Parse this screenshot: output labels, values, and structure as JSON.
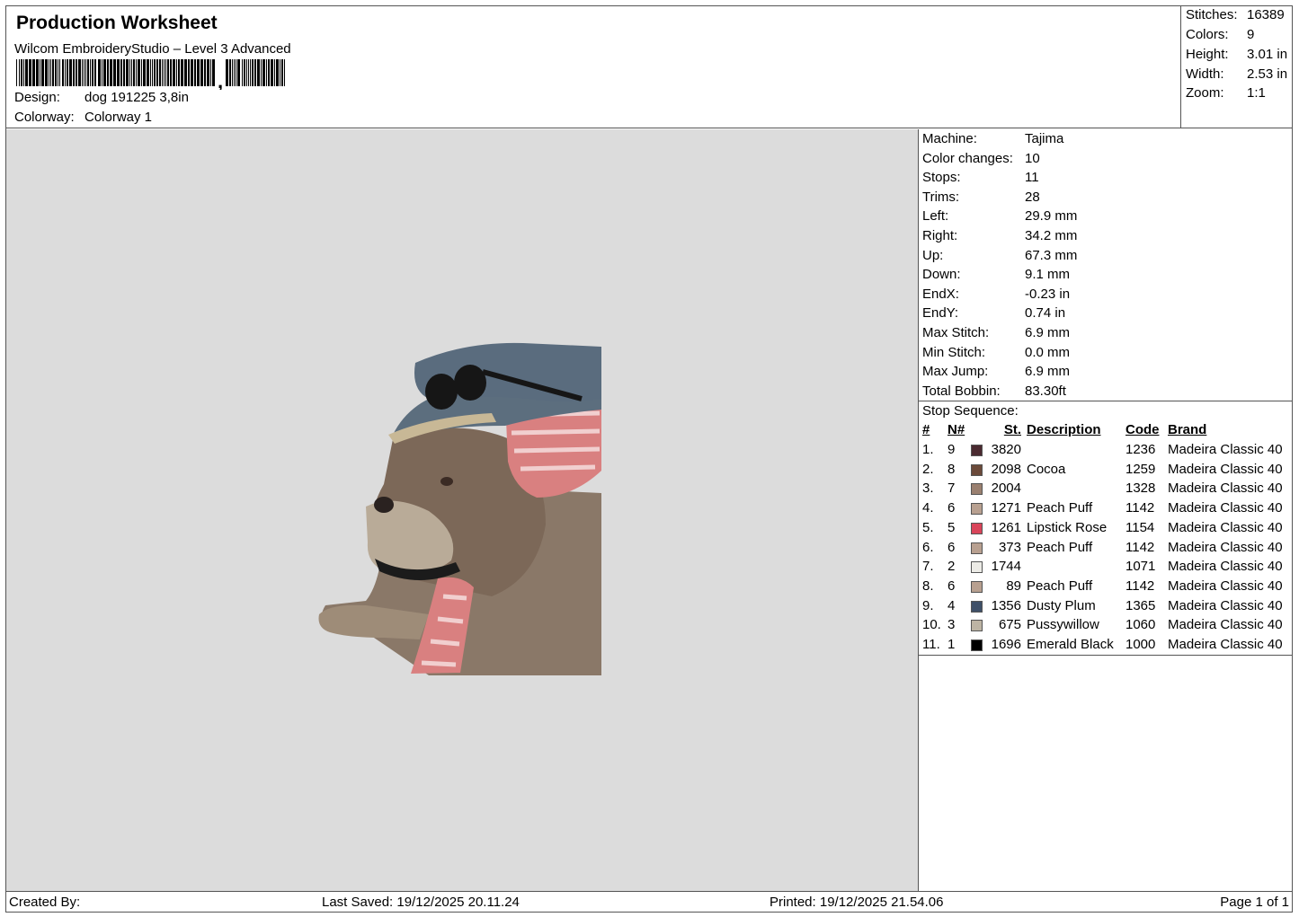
{
  "header": {
    "title": "Production Worksheet",
    "subtitle": "Wilcom EmbroideryStudio – Level 3 Advanced",
    "design_label": "Design:",
    "design_value": "dog 191225 3,8in",
    "colorway_label": "Colorway:",
    "colorway_value": "Colorway 1"
  },
  "summary": {
    "stitches_label": "Stitches:",
    "stitches_value": "16389",
    "colors_label": "Colors:",
    "colors_value": "9",
    "height_label": "Height:",
    "height_value": "3.01 in",
    "width_label": "Width:",
    "width_value": "2.53 in",
    "zoom_label": "Zoom:",
    "zoom_value": "1:1"
  },
  "machine": [
    {
      "label": "Machine:",
      "value": "Tajima"
    },
    {
      "label": "Color changes:",
      "value": "10"
    },
    {
      "label": "Stops:",
      "value": "11"
    },
    {
      "label": "Trims:",
      "value": "28"
    },
    {
      "label": "Left:",
      "value": "29.9 mm"
    },
    {
      "label": "Right:",
      "value": "34.2 mm"
    },
    {
      "label": "Up:",
      "value": "67.3 mm"
    },
    {
      "label": "Down:",
      "value": "9.1 mm"
    },
    {
      "label": "EndX:",
      "value": "-0.23 in"
    },
    {
      "label": "EndY:",
      "value": "0.74 in"
    },
    {
      "label": "Max Stitch:",
      "value": "6.9 mm"
    },
    {
      "label": "Min Stitch:",
      "value": "0.0 mm"
    },
    {
      "label": "Max Jump:",
      "value": "6.9 mm"
    },
    {
      "label": "Total Bobbin:",
      "value": "83.30ft"
    }
  ],
  "stop_sequence": {
    "caption": "Stop Sequence:",
    "headers": {
      "idx": "#",
      "num": "N#",
      "st": "St.",
      "desc": "Description",
      "code": "Code",
      "brand": "Brand"
    },
    "rows": [
      {
        "idx": "1.",
        "num": "9",
        "color": "#4a2a30",
        "st": "3820",
        "desc": "",
        "code": "1236",
        "brand": "Madeira Classic 40"
      },
      {
        "idx": "2.",
        "num": "8",
        "color": "#6b4a3a",
        "st": "2098",
        "desc": "Cocoa",
        "code": "1259",
        "brand": "Madeira Classic 40"
      },
      {
        "idx": "3.",
        "num": "7",
        "color": "#9a8070",
        "st": "2004",
        "desc": "",
        "code": "1328",
        "brand": "Madeira Classic 40"
      },
      {
        "idx": "4.",
        "num": "6",
        "color": "#b8a090",
        "st": "1271",
        "desc": "Peach Puff",
        "code": "1142",
        "brand": "Madeira Classic 40"
      },
      {
        "idx": "5.",
        "num": "5",
        "color": "#d9455a",
        "st": "1261",
        "desc": "Lipstick Rose",
        "code": "1154",
        "brand": "Madeira Classic 40"
      },
      {
        "idx": "6.",
        "num": "6",
        "color": "#b8a090",
        "st": "373",
        "desc": "Peach Puff",
        "code": "1142",
        "brand": "Madeira Classic 40"
      },
      {
        "idx": "7.",
        "num": "2",
        "color": "#ecebe6",
        "st": "1744",
        "desc": "",
        "code": "1071",
        "brand": "Madeira Classic 40"
      },
      {
        "idx": "8.",
        "num": "6",
        "color": "#b8a090",
        "st": "89",
        "desc": "Peach Puff",
        "code": "1142",
        "brand": "Madeira Classic 40"
      },
      {
        "idx": "9.",
        "num": "4",
        "color": "#3f5068",
        "st": "1356",
        "desc": "Dusty Plum",
        "code": "1365",
        "brand": "Madeira Classic 40"
      },
      {
        "idx": "10.",
        "num": "3",
        "color": "#bdb4a4",
        "st": "675",
        "desc": "Pussywillow",
        "code": "1060",
        "brand": "Madeira Classic 40"
      },
      {
        "idx": "11.",
        "num": "1",
        "color": "#000000",
        "st": "1696",
        "desc": "Emerald Black",
        "code": "1000",
        "brand": "Madeira Classic 40"
      }
    ]
  },
  "footer": {
    "created_by": "Created By:",
    "last_saved": "Last Saved: 19/12/2025 20.11.24",
    "printed": "Printed: 19/12/2025 21.54.06",
    "page": "Page 1 of 1"
  },
  "colors": {
    "canvas_bg": "#dcdcdc",
    "border": "#555555"
  },
  "icons": {
    "barcode": "barcode-icon",
    "design_preview": "dog-embroidery-image"
  }
}
